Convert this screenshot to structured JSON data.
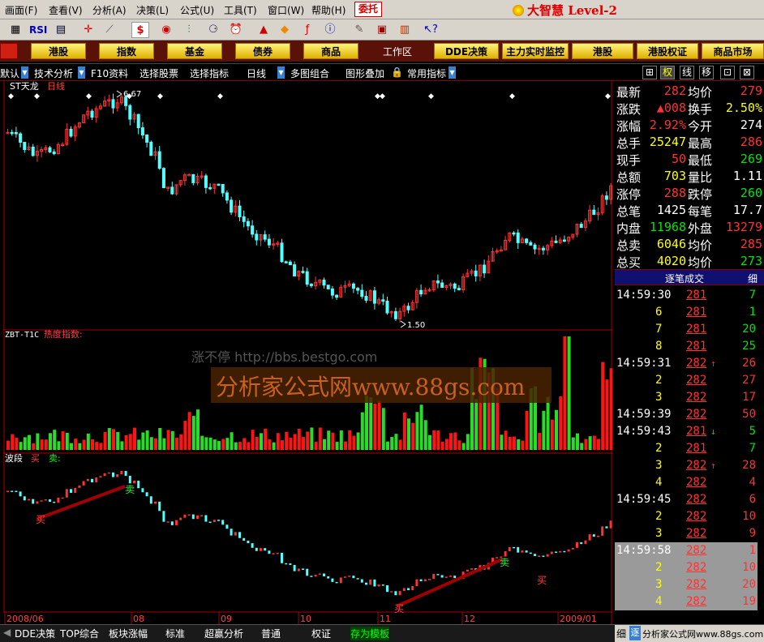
{
  "menu": {
    "items": [
      "画面(F)",
      "查看(V)",
      "分析(A)",
      "决策(L)",
      "公式(U)",
      "工具(T)",
      "窗口(W)",
      "帮助(H)"
    ],
    "entrust": "委托",
    "brand": "大智慧 Level-2"
  },
  "toolbar": {
    "icons": [
      "chart-icon",
      "rsi-icon",
      "table-icon",
      "crosshair-icon",
      "ruler-icon",
      "dollar-icon",
      "bar-icon",
      "multi-icon",
      "binoculars-icon",
      "alarm-icon",
      "up-icon",
      "diamond-icon",
      "f10-icon",
      "info-icon",
      "notepad-icon",
      "window-icon",
      "books-icon",
      "help-icon"
    ],
    "rsi_label": "RSI"
  },
  "nav": {
    "items": [
      "港股",
      "指数",
      "基金",
      "债券",
      "商品"
    ],
    "workspace": "工作区",
    "right_items": [
      "DDE决策",
      "主力实时监控",
      "港股",
      "港股权证",
      "商品市场"
    ]
  },
  "subbar": {
    "items": [
      "默认",
      "技术分析",
      "F10资料",
      "选择股票",
      "选择指标",
      "日线",
      "多图组合",
      "图形叠加",
      "常用指标"
    ],
    "right_buttons": [
      "⊞",
      "权",
      "线",
      "移",
      "⊡",
      "⊠"
    ]
  },
  "chart": {
    "stock_label": "ST天龙",
    "period_label": "日线",
    "high_marker": "6.67",
    "low_marker": "1.50",
    "indicator1": "ZBT-T1C",
    "indicator1_name": "热度指数:",
    "watermark1": "涨不停 http://bbs.bestgo.com",
    "watermark2": "分析家公式网www.88gs.com",
    "indicator2": "波段",
    "buy_label": "买",
    "sell_label": "卖:",
    "buy_mark": "买",
    "sell_mark": "卖",
    "dates": [
      "2008/06",
      "08",
      "09",
      "10",
      "11",
      "12",
      "2009/01"
    ],
    "colors": {
      "up": "#ff3232",
      "down": "#54ffff",
      "bullish": "#ff1414",
      "bearish": "#28dc28",
      "trend": "#a00000"
    }
  },
  "chart_data": {
    "type": "candlestick",
    "price_range": [
      1.5,
      6.67
    ],
    "date_labels": [
      "2008/06",
      "08",
      "09",
      "10",
      "11",
      "12",
      "2009/01"
    ]
  },
  "quote": {
    "rows": [
      {
        "l": "最新",
        "v": "282",
        "vc": "red",
        "l2": "均价",
        "v2": "279",
        "v2c": "red"
      },
      {
        "l": "涨跌",
        "v": "▲008",
        "vc": "red",
        "l2": "换手",
        "v2": "2.50%",
        "v2c": "yellow"
      },
      {
        "l": "涨幅",
        "v": "2.92%",
        "vc": "red",
        "l2": "今开",
        "v2": "274",
        "v2c": "white"
      },
      {
        "l": "总手",
        "v": "25247",
        "vc": "yellow",
        "l2": "最高",
        "v2": "286",
        "v2c": "red"
      },
      {
        "l": "现手",
        "v": "50",
        "vc": "red",
        "l2": "最低",
        "v2": "269",
        "v2c": "green"
      },
      {
        "l": "总额",
        "v": "703",
        "vc": "yellow",
        "l2": "量比",
        "v2": "1.11",
        "v2c": "white"
      },
      {
        "l": "涨停",
        "v": "288",
        "vc": "red",
        "l2": "跌停",
        "v2": "260",
        "v2c": "green"
      },
      {
        "l": "总笔",
        "v": "1425",
        "vc": "white",
        "l2": "每笔",
        "v2": "17.7",
        "v2c": "white"
      },
      {
        "l": "内盘",
        "v": "11968",
        "vc": "green",
        "l2": "外盘",
        "v2": "13279",
        "v2c": "red"
      },
      {
        "l": "总卖",
        "v": "6046",
        "vc": "yellow",
        "l2": "均价",
        "v2": "285",
        "v2c": "red"
      },
      {
        "l": "总买",
        "v": "4020",
        "vc": "yellow",
        "l2": "均价",
        "v2": "273",
        "v2c": "green"
      }
    ]
  },
  "trades_header": {
    "title": "逐笔成交",
    "detail": "细"
  },
  "trades": [
    {
      "time": "14:59:30",
      "price": "281",
      "arrow": "",
      "qty": "7",
      "qc": "green",
      "tc": "white"
    },
    {
      "time": "",
      "price": "281",
      "arrow": "",
      "qty": "1",
      "qc": "green",
      "tc": "yellow",
      "pre": "6"
    },
    {
      "time": "",
      "price": "281",
      "arrow": "",
      "qty": "20",
      "qc": "green",
      "tc": "yellow",
      "pre": "7"
    },
    {
      "time": "",
      "price": "281",
      "arrow": "",
      "qty": "25",
      "qc": "green",
      "tc": "yellow",
      "pre": "8"
    },
    {
      "time": "14:59:31",
      "price": "282",
      "arrow": "↑",
      "ac": "red",
      "qty": "26",
      "qc": "red",
      "tc": "white"
    },
    {
      "time": "",
      "price": "282",
      "arrow": "",
      "qty": "27",
      "qc": "red",
      "tc": "yellow",
      "pre": "2"
    },
    {
      "time": "",
      "price": "282",
      "arrow": "",
      "qty": "17",
      "qc": "red",
      "tc": "yellow",
      "pre": "3"
    },
    {
      "time": "14:59:39",
      "price": "282",
      "arrow": "",
      "qty": "50",
      "qc": "red",
      "tc": "white"
    },
    {
      "time": "14:59:43",
      "price": "281",
      "arrow": "↓",
      "ac": "green",
      "qty": "5",
      "qc": "green",
      "tc": "white"
    },
    {
      "time": "",
      "price": "281",
      "arrow": "",
      "qty": "7",
      "qc": "green",
      "tc": "yellow",
      "pre": "2"
    },
    {
      "time": "",
      "price": "282",
      "arrow": "↑",
      "ac": "red",
      "qty": "28",
      "qc": "red",
      "tc": "yellow",
      "pre": "3"
    },
    {
      "time": "",
      "price": "282",
      "arrow": "",
      "qty": "4",
      "qc": "red",
      "tc": "yellow",
      "pre": "4"
    },
    {
      "time": "14:59:45",
      "price": "282",
      "arrow": "",
      "qty": "6",
      "qc": "red",
      "tc": "white"
    },
    {
      "time": "",
      "price": "282",
      "arrow": "",
      "qty": "10",
      "qc": "red",
      "tc": "yellow",
      "pre": "2"
    },
    {
      "time": "",
      "price": "282",
      "arrow": "",
      "qty": "9",
      "qc": "red",
      "tc": "yellow",
      "pre": "3"
    },
    {
      "time": "14:59:58",
      "price": "282",
      "arrow": "",
      "qty": "1",
      "qc": "red",
      "tc": "white",
      "hl": true
    },
    {
      "time": "",
      "price": "282",
      "arrow": "",
      "qty": "10",
      "qc": "red",
      "tc": "yellow",
      "pre": "2",
      "hl": true
    },
    {
      "time": "",
      "price": "282",
      "arrow": "",
      "qty": "20",
      "qc": "red",
      "tc": "yellow",
      "pre": "3",
      "hl": true
    },
    {
      "time": "",
      "price": "282",
      "arrow": "",
      "qty": "19",
      "qc": "red",
      "tc": "yellow",
      "pre": "4",
      "hl": true
    }
  ],
  "bottom": {
    "tabs": [
      "DDE决策",
      "TOP综合",
      "板块涨幅",
      "标准",
      "超赢分析",
      "普通",
      "权证",
      "存为模板"
    ],
    "right_label": "细",
    "right_tab": "逐",
    "site": "分析家公式网www.88gs.com"
  }
}
